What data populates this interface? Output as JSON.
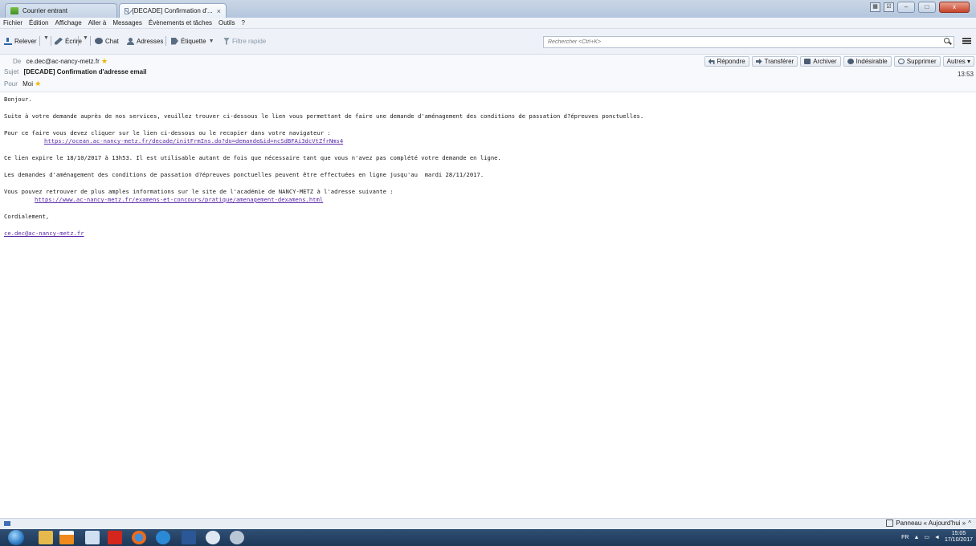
{
  "tabs": [
    {
      "label": "Courrier entrant",
      "active": false
    },
    {
      "label": "[DECADE] Confirmation d'...",
      "active": true
    }
  ],
  "window_buttons": {
    "minimize": "–",
    "maximize": "□",
    "close": "x"
  },
  "menu": [
    "Fichier",
    "Édition",
    "Affichage",
    "Aller à",
    "Messages",
    "Évènements et tâches",
    "Outils",
    "?"
  ],
  "toolbar": {
    "get_label": "Relever",
    "write_label": "Écrire",
    "chat_label": "Chat",
    "address_label": "Adresses",
    "tag_label": "Étiquette",
    "quickfilter_label": "Filtre rapide",
    "search_placeholder": "Rechercher <Ctrl+K>"
  },
  "header": {
    "from_label": "De",
    "from_value": "ce.dec@ac-nancy-metz.fr",
    "subject_label": "Sujet",
    "subject_value": "[DECADE] Confirmation d'adresse email",
    "to_label": "Pour",
    "to_value": "Moi",
    "time": "13:53",
    "actions": {
      "reply": "Répondre",
      "forward": "Transférer",
      "archive": "Archiver",
      "junk": "Indésirable",
      "delete": "Supprimer",
      "other": "Autres ▾"
    }
  },
  "body": {
    "greeting": "Bonjour.",
    "p1": "Suite à votre demande auprès de nos services, veuillez trouver ci-dessous le lien vous permettant de faire une demande d'aménagement des conditions de passation d?épreuves ponctuelles.",
    "p2": "Pour ce faire vous devez cliquer sur le lien ci-dessous ou le recopier dans votre navigateur :",
    "link1": "https://ocean.ac-nancy-metz.fr/decade/initFrmIns.do?do=demande&id=ncSdBFAi3dcVtZfrNms4",
    "p3": "Ce lien expire le 18/10/2017 à 13h53. Il est utilisable autant de fois que nécessaire tant que vous n'avez pas complété votre demande en ligne.",
    "p4": "Les demandes d'aménagement des conditions de passation d?épreuves ponctuelles peuvent être effectuées en ligne jusqu'au  mardi 28/11/2017.",
    "p5": "Vous pouvez retrouver de plus amples informations sur le site de l'académie de NANCY-METZ à l'adresse suivante :",
    "link2": "https://www.ac-nancy-metz.fr/examens-et-concours/pratique/amenagement-dexamens.html",
    "closing": "Cordialement,",
    "signature_link": "ce.dec@ac-nancy-metz.fr"
  },
  "statusbar": {
    "panel_label": "Panneau « Aujourd'hui »"
  },
  "taskbar": {
    "lang": "FR",
    "time": "15:05",
    "date": "17/10/2017",
    "apps": [
      "windows-explorer",
      "vlc",
      "notepad",
      "acrobat-reader",
      "firefox",
      "internet-explorer",
      "word",
      "thunderbird",
      "other-app"
    ]
  },
  "colors": {
    "link": "#5a2aa8",
    "taskbar": "#1d3858",
    "close_button": "#c7432a"
  }
}
